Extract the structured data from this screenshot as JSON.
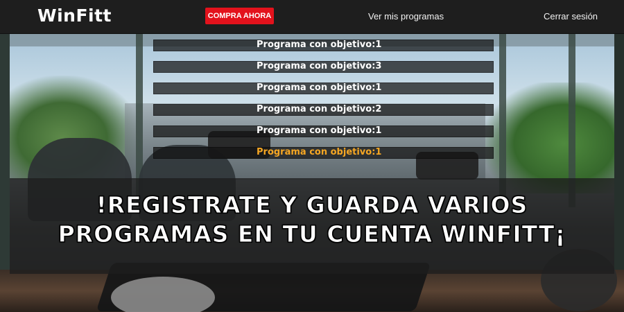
{
  "navbar": {
    "logo": "WinFitt",
    "buy_label": "COMPRA AHORA",
    "programs_link": "Ver mis programas",
    "logout_link": "Cerrar sesión"
  },
  "programs": [
    {
      "label": "Programa con objetivo:1",
      "active": false
    },
    {
      "label": "Programa con objetivo:3",
      "active": false
    },
    {
      "label": "Programa con objetivo:1",
      "active": false
    },
    {
      "label": "Programa con objetivo:2",
      "active": false
    },
    {
      "label": "Programa con objetivo:1",
      "active": false
    },
    {
      "label": "Programa con objetivo:1",
      "active": true
    }
  ],
  "banner": {
    "line1": "!REGISTRATE Y GUARDA VARIOS",
    "line2": "PROGRAMAS EN TU CUENTA WINFITT¡"
  },
  "colors": {
    "accent_button": "#e3121c",
    "active_program": "#f5a623",
    "navbar": "#1e1e1e"
  }
}
